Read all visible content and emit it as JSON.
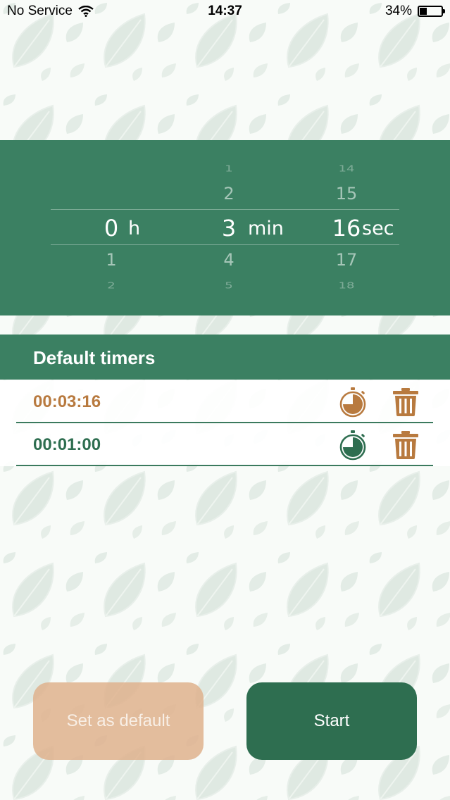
{
  "status_bar": {
    "carrier": "No Service",
    "time": "14:37",
    "battery_percent_label": "34%",
    "battery_level": 0.34
  },
  "picker": {
    "hours": {
      "above2": "",
      "above1": "",
      "selected": "0",
      "below1": "1",
      "below2": "2",
      "unit": "h"
    },
    "minutes": {
      "above2": "1",
      "above1": "2",
      "selected": "3",
      "below1": "4",
      "below2": "5",
      "unit": "min"
    },
    "seconds": {
      "above2": "14",
      "above1": "15",
      "selected": "16",
      "below1": "17",
      "below2": "18",
      "unit": "sec"
    }
  },
  "default_timers": {
    "title": "Default timers",
    "items": [
      {
        "time": "00:03:16",
        "color": "#b87a3f",
        "icon": "stopwatch-icon"
      },
      {
        "time": "00:01:00",
        "color": "#2e6e50",
        "icon": "stopwatch-icon"
      }
    ]
  },
  "buttons": {
    "set_default_label": "Set as default",
    "start_label": "Start"
  },
  "colors": {
    "primary_green": "#3b8062",
    "dark_green": "#2e6e50",
    "accent_brown": "#b87a3f",
    "button_tan": "#dfb28d"
  }
}
